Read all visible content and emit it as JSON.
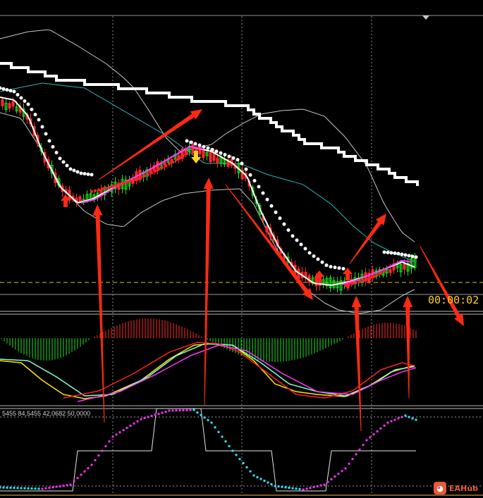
{
  "chart_data": [
    {
      "type": "line",
      "panel": "price",
      "candles_count": 118,
      "series": [],
      "annotations": [
        "buy-arrow",
        "sell-arrow",
        "buy-arrow",
        "buy-arrow"
      ]
    },
    {
      "type": "bar",
      "panel": "oscillator",
      "series": []
    },
    {
      "type": "line",
      "panel": "stochastic",
      "series": []
    }
  ],
  "price_panel": {
    "countdown": "00:00:02"
  },
  "indicator_panel": {
    "label": "5455 84,5455 42,0682 50,0000"
  },
  "colors": {
    "background": "#000000",
    "bull_candle": "#19e619",
    "bear_candle": "#ff2a2a",
    "white_line": "#ffffff",
    "magenta_line": "#ff33ff",
    "cyan_line": "#2fb4b4",
    "band_line": "#c8c8c8",
    "red_dots": "#ff2020",
    "yellow": "#ffd21f",
    "red_arrow": "#ff2a14",
    "cyan_dots": "#33e0ee"
  },
  "watermark": {
    "icon": "fox-logo-icon",
    "text": "EAHub"
  }
}
